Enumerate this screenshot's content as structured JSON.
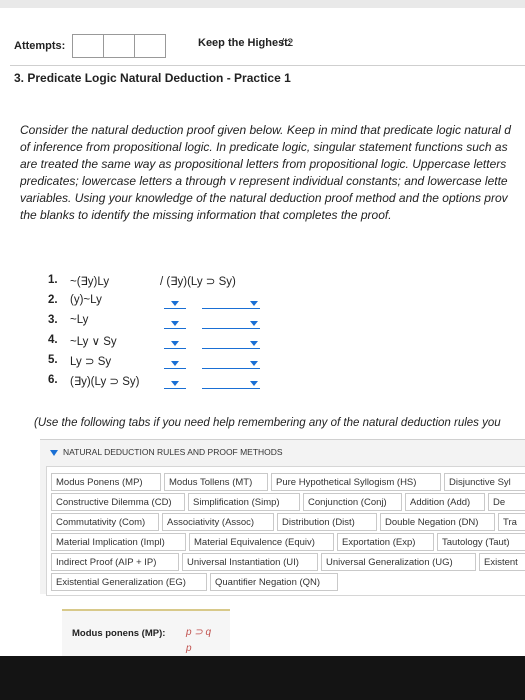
{
  "header": {
    "attempts_label": "Attempts:",
    "keep_label": "Keep the Highest:",
    "keep_value": "/ 2"
  },
  "question": {
    "title": "3. Predicate Logic Natural Deduction - Practice 1",
    "instructions": [
      "Consider the natural deduction proof given below. Keep in mind that predicate logic natural d",
      "of inference from propositional logic. In predicate logic, singular statement functions such as",
      "are treated the same way as propositional letters from propositional logic. Uppercase letters",
      "predicates; lowercase letters a through v represent individual constants; and lowercase lette",
      "variables. Using your knowledge of the natural deduction proof method and the options prov",
      "the blanks to identify the missing information that completes the proof."
    ]
  },
  "proof": {
    "conclusion": "/ (∃y)(Ly ⊃ Sy)",
    "steps": [
      {
        "num": "1.",
        "formula": "~(∃y)Ly"
      },
      {
        "num": "2.",
        "formula": "(y)~Ly"
      },
      {
        "num": "3.",
        "formula": "~Ly"
      },
      {
        "num": "4.",
        "formula": "~Ly ∨ Sy"
      },
      {
        "num": "5.",
        "formula": "Ly ⊃ Sy"
      },
      {
        "num": "6.",
        "formula": "(∃y)(Ly ⊃ Sy)"
      }
    ]
  },
  "tabs_hint": "(Use the following tabs if you need help remembering any of the natural deduction rules you",
  "rules": {
    "header": "NATURAL DEDUCTION RULES AND PROOF METHODS",
    "rows": [
      [
        "Modus Ponens (MP)",
        "Modus Tollens (MT)",
        "Pure Hypothetical Syllogism (HS)",
        "Disjunctive Syl"
      ],
      [
        "Constructive Dilemma (CD)",
        "Simplification (Simp)",
        "Conjunction (Conj)",
        "Addition (Add)",
        "De"
      ],
      [
        "Commutativity (Com)",
        "Associativity (Assoc)",
        "Distribution (Dist)",
        "Double Negation (DN)",
        "Tra"
      ],
      [
        "Material Implication (Impl)",
        "Material Equivalence (Equiv)",
        "Exportation (Exp)",
        "Tautology (Taut)"
      ],
      [
        "Indirect Proof (AIP + IP)",
        "Universal Instantiation (UI)",
        "Universal Generalization (UG)",
        "Existent"
      ],
      [
        "Existential Generalization (EG)",
        "Quantifier Negation (QN)"
      ]
    ]
  },
  "detail": {
    "label": "Modus ponens (MP):",
    "line1": "p ⊃ q",
    "line2": "p"
  },
  "colors": {
    "accent": "#1a6fd4",
    "formula_red": "#c0504d"
  }
}
